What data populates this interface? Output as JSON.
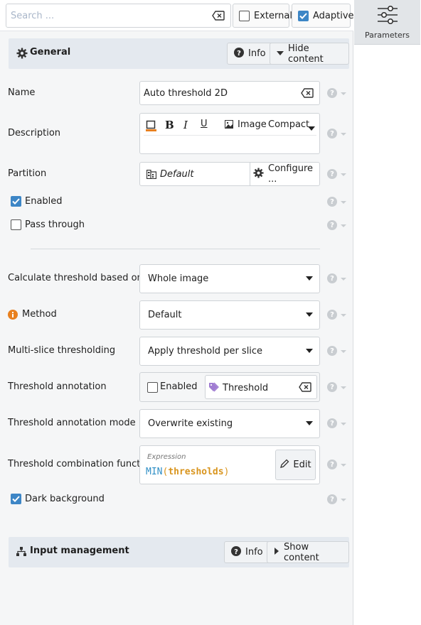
{
  "search": {
    "placeholder": "Search ..."
  },
  "toolbar": {
    "external_label": "External",
    "adaptive_label": "Adaptive"
  },
  "right_tab": {
    "label": "Parameters"
  },
  "general": {
    "title": "General",
    "info_label": "Info",
    "hide_label": "Hide content"
  },
  "params": {
    "name_label": "Name",
    "name_value": "Auto threshold 2D",
    "description_label": "Description",
    "image_label": "Image",
    "compact_label": "Compact",
    "partition_label": "Partition",
    "partition_value": "Default",
    "configure_label": "Configure ...",
    "enabled_label": "Enabled",
    "pass_through_label": "Pass through",
    "calc_label": "Calculate threshold based on ...",
    "calc_value": "Whole image",
    "method_label": "Method",
    "method_value": "Default",
    "multislice_label": "Multi-slice thresholding",
    "multislice_value": "Apply threshold per slice",
    "annotation_label": "Threshold annotation",
    "annotation_enabled_label": "Enabled",
    "annotation_value": "Threshold",
    "annotation_mode_label": "Threshold annotation mode",
    "annotation_mode_value": "Overwrite existing",
    "combination_label": "Threshold combination function",
    "expression_caption": "Expression",
    "expr_func": "MIN",
    "expr_open": "(",
    "expr_arg": "thresholds",
    "expr_close": ")",
    "edit_label": "Edit",
    "dark_bg_label": "Dark background",
    "help_glyph": "?"
  },
  "input_mgmt": {
    "title": "Input management",
    "info_label": "Info",
    "show_label": "Show content"
  },
  "colors": {
    "accent": "#3d86c6",
    "warning": "#e8801f",
    "expr_func": "#2f8fc6",
    "expr_arg": "#d9951e",
    "tag": "#a07cd2"
  }
}
